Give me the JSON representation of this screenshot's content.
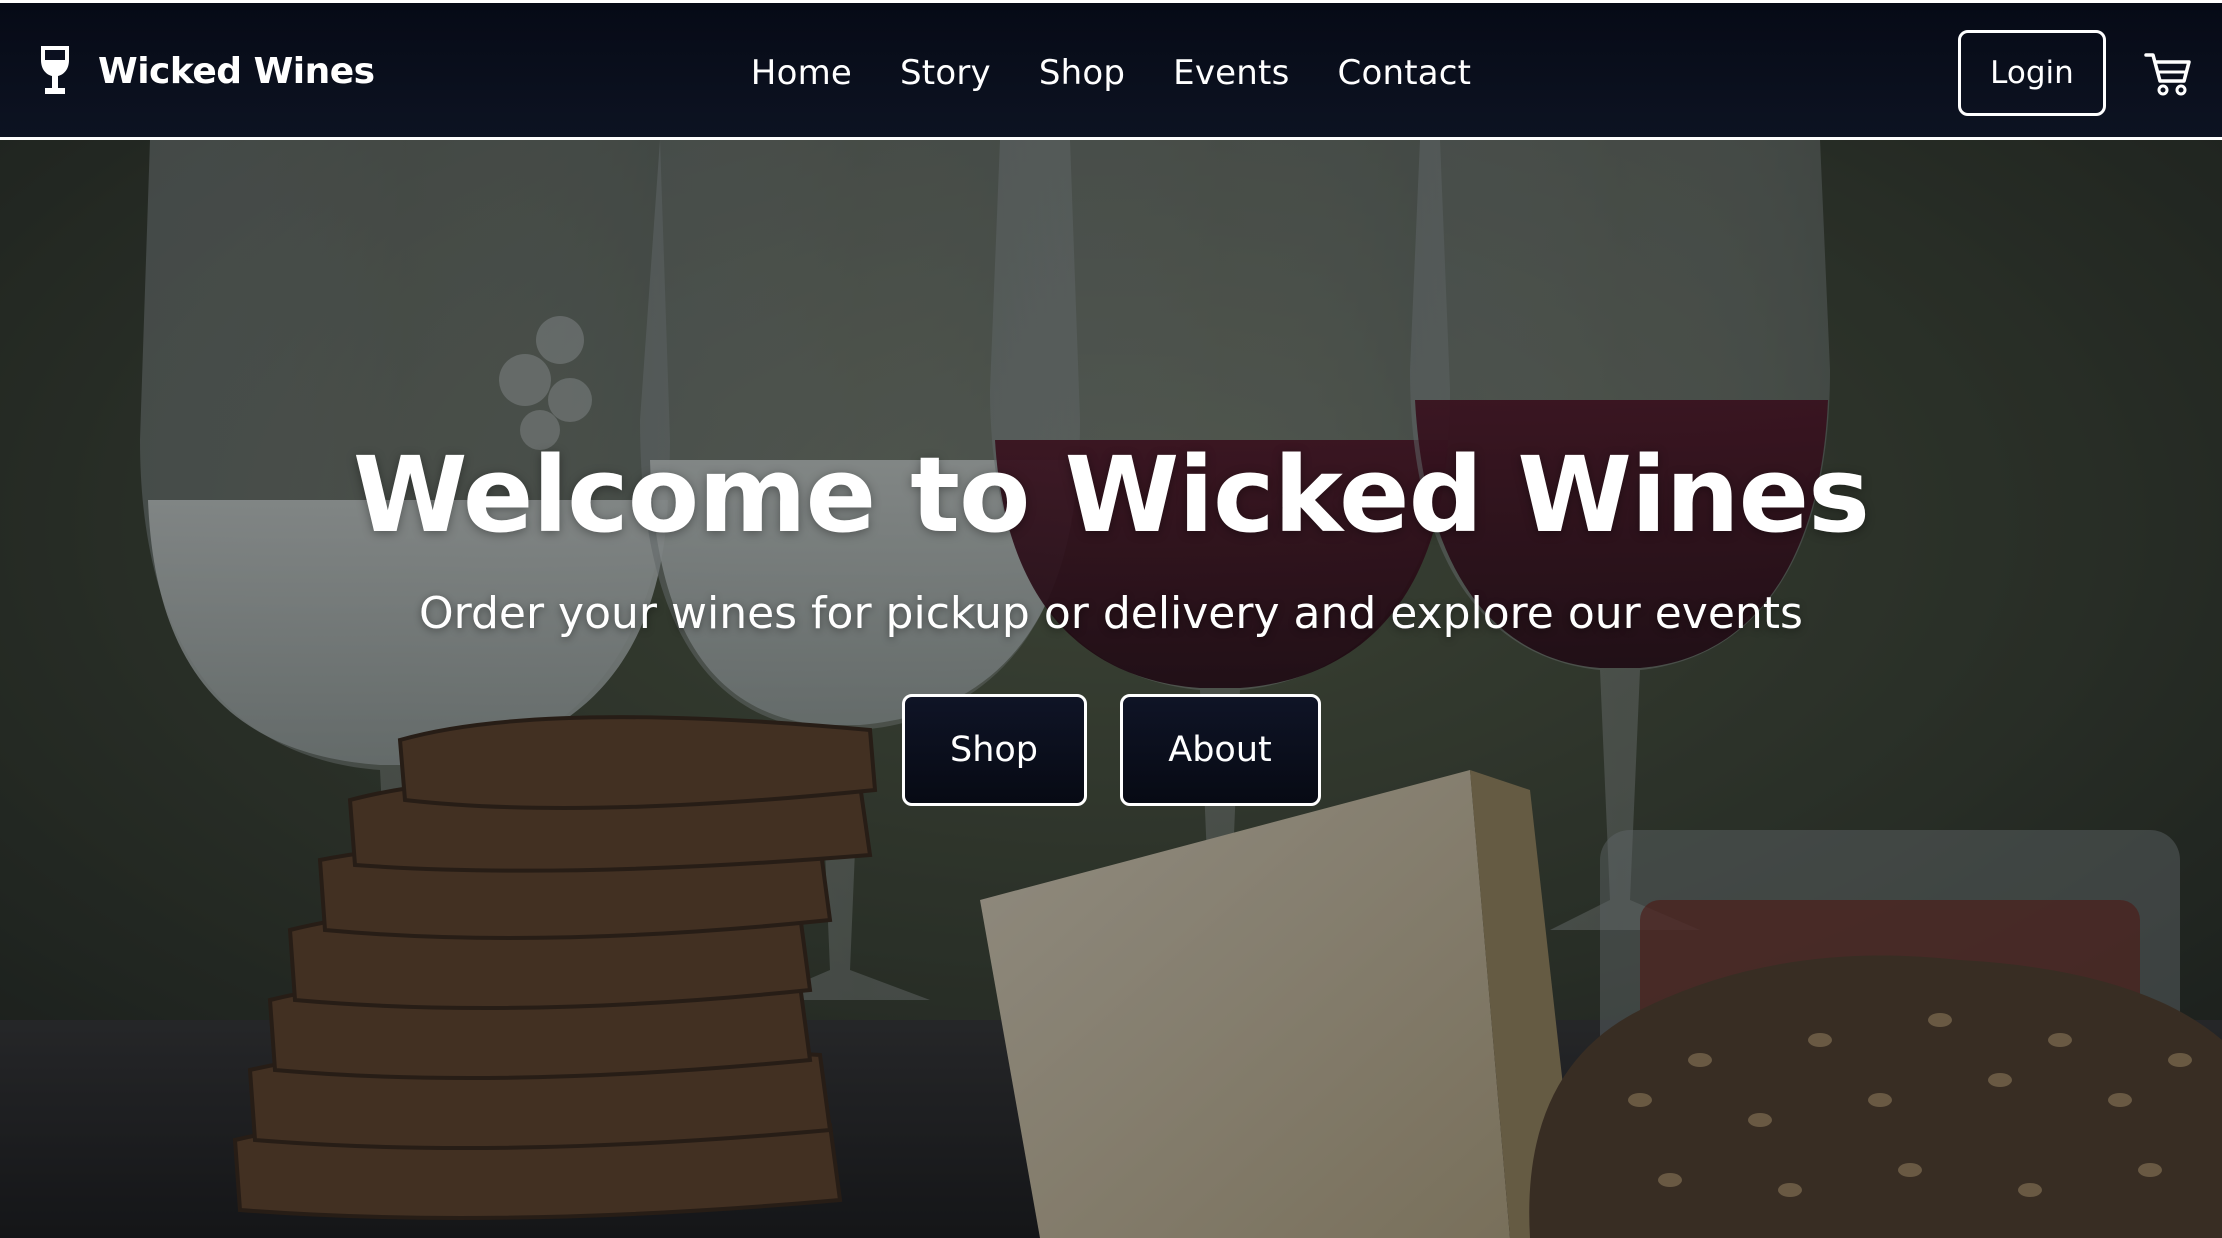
{
  "brand": {
    "name": "Wicked Wines",
    "icon": "wine-glass-icon"
  },
  "nav": {
    "links": [
      {
        "label": "Home"
      },
      {
        "label": "Story"
      },
      {
        "label": "Shop"
      },
      {
        "label": "Events"
      },
      {
        "label": "Contact"
      }
    ],
    "login_label": "Login",
    "cart_icon": "cart-icon"
  },
  "hero": {
    "title": "Welcome to Wicked Wines",
    "subtitle": "Order your wines for pickup or delivery and explore our events",
    "buttons": [
      {
        "label": "Shop"
      },
      {
        "label": "About"
      }
    ]
  },
  "colors": {
    "navbar_bg": "#0b1020",
    "text": "#ffffff",
    "button_bg": "#0b0f1e",
    "border": "#ffffff"
  }
}
